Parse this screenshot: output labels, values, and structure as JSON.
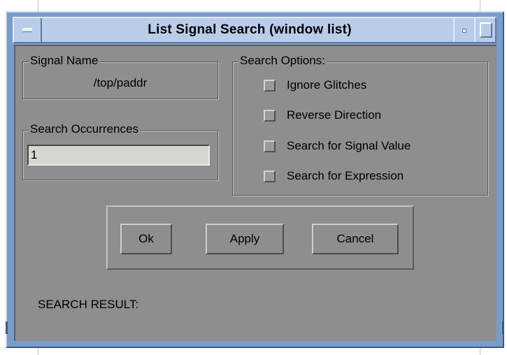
{
  "window": {
    "title": "List Signal Search (window list)"
  },
  "signal_name": {
    "label": "Signal Name",
    "value": "/top/paddr"
  },
  "search_occurrences": {
    "label": "Search Occurrences",
    "value": "1"
  },
  "search_options": {
    "label": "Search Options:",
    "items": [
      {
        "label": "Ignore Glitches",
        "checked": false
      },
      {
        "label": "Reverse Direction",
        "checked": false
      },
      {
        "label": "Search for Signal Value",
        "checked": false
      },
      {
        "label": "Search for Expression",
        "checked": false
      }
    ]
  },
  "buttons": {
    "ok": "Ok",
    "apply": "Apply",
    "cancel": "Cancel"
  },
  "result": {
    "label": "SEARCH RESULT:"
  },
  "colors": {
    "dialog_bg": "#8e8e8e",
    "title_bar": "#b9cce9",
    "frame": "#7a9cc9",
    "input_bg": "#d3d8d0"
  },
  "icons": {
    "window_menu": "window-menu-icon",
    "minimize": "minimize-icon",
    "maximize": "maximize-icon"
  }
}
